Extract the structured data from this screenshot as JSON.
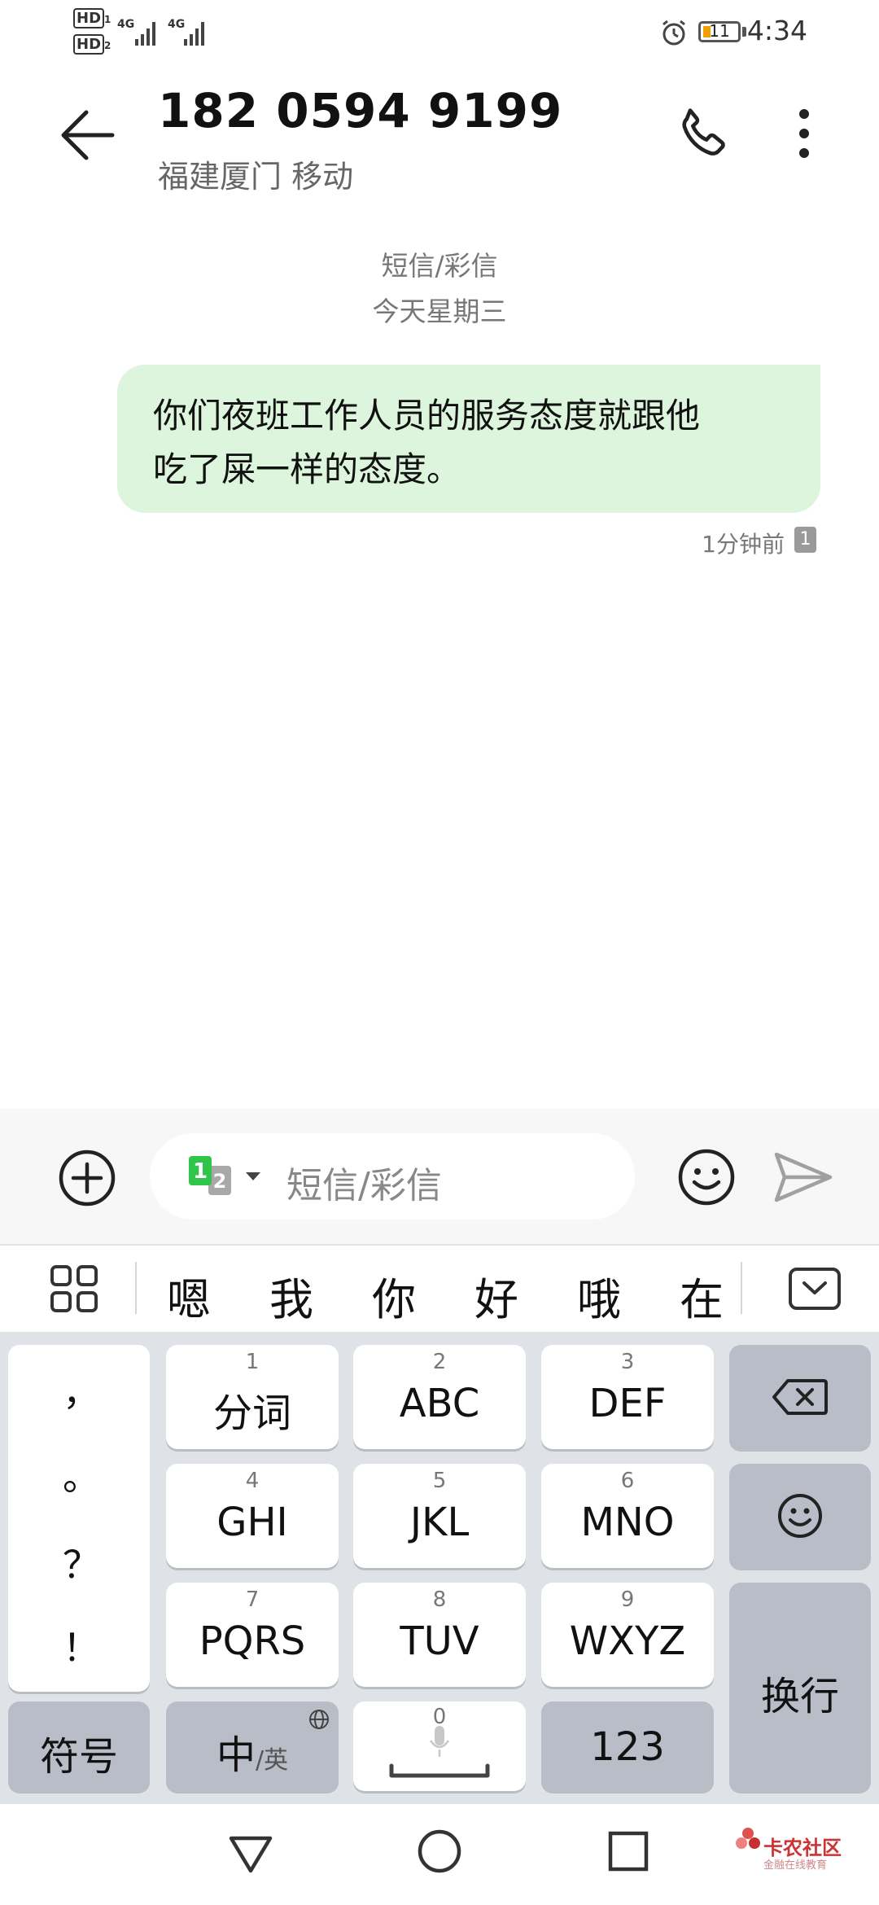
{
  "status_bar": {
    "sim1_label": "HD",
    "sim1_index": "1",
    "sim2_label": "HD",
    "sim2_index": "2",
    "net1": "4G",
    "net2": "4G",
    "battery_level": "11",
    "time": "4:34"
  },
  "header": {
    "contact_number": "182 0594 9199",
    "contact_location": "福建厦门 移动"
  },
  "conversation": {
    "type_label": "短信/彩信",
    "date_label": "今天星期三",
    "messages": [
      {
        "text_line1": "你们夜班工作人员的服务态度就跟他",
        "text_line2": "吃了屎一样的态度。",
        "time": "1分钟前",
        "sim_slot": "1"
      }
    ]
  },
  "compose": {
    "sim_primary": "1",
    "sim_secondary": "2",
    "placeholder": "短信/彩信"
  },
  "candidates": [
    "嗯",
    "我",
    "你",
    "好",
    "哦",
    "在"
  ],
  "keyboard": {
    "punctuation": [
      "，",
      "。",
      "？",
      "！"
    ],
    "keys": [
      {
        "num": "1",
        "label": "分词"
      },
      {
        "num": "2",
        "label": "ABC"
      },
      {
        "num": "3",
        "label": "DEF"
      },
      {
        "num": "4",
        "label": "GHI"
      },
      {
        "num": "5",
        "label": "JKL"
      },
      {
        "num": "6",
        "label": "MNO"
      },
      {
        "num": "7",
        "label": "PQRS"
      },
      {
        "num": "8",
        "label": "TUV"
      },
      {
        "num": "9",
        "label": "WXYZ"
      }
    ],
    "symbol_key": "符号",
    "lang_key_main": "中",
    "lang_key_sub": "/英",
    "space_num": "0",
    "numeric_key": "123",
    "enter_key": "换行"
  },
  "watermark": {
    "title": "卡农社区",
    "subtitle": "金融在线教育"
  },
  "colors": {
    "bubble": "#ddf5dd",
    "sim_green": "#2fc54a",
    "battery": "#f0a000",
    "keyboard_bg": "#dfe2e7",
    "dark_key": "#b8bdc7"
  },
  "icons": {
    "back": "back-arrow-icon",
    "call": "phone-icon",
    "more": "more-vertical-icon",
    "add": "add-circle-icon",
    "emoji": "emoji-icon",
    "send": "send-icon",
    "grid": "grid-icon",
    "hide_keyboard": "hide-keyboard-icon",
    "backspace": "backspace-icon",
    "keyboard_emoji": "emoji-key-icon",
    "globe": "globe-icon",
    "mic": "mic-icon",
    "nav_back": "nav-back-icon",
    "nav_home": "nav-home-icon",
    "nav_recent": "nav-recents-icon"
  }
}
